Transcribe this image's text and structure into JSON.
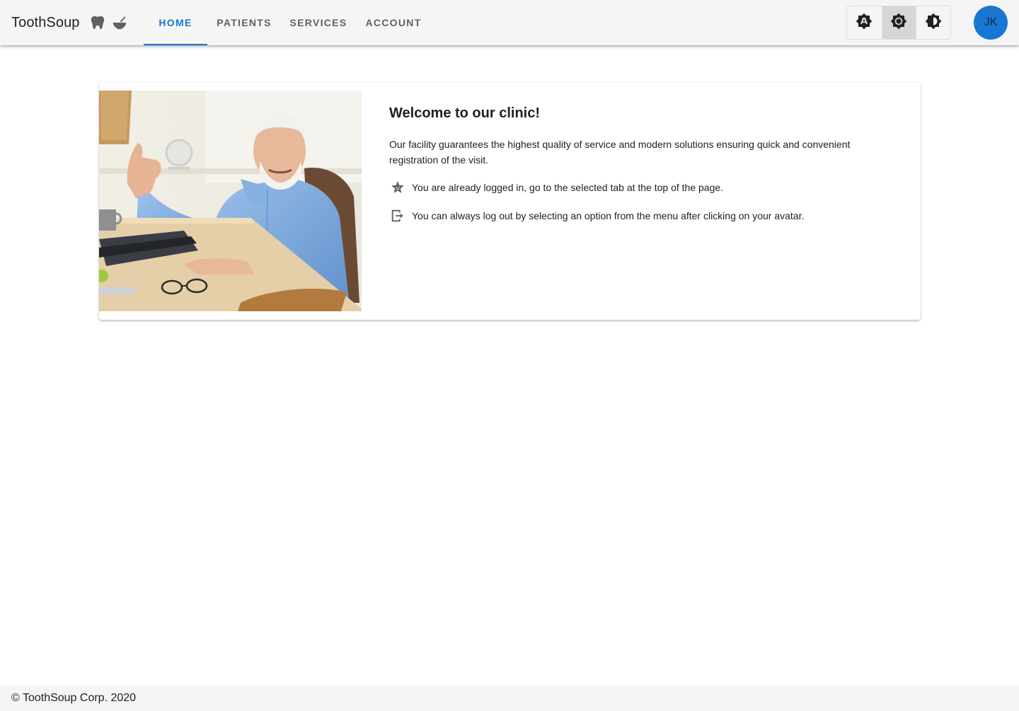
{
  "app": {
    "title": "ToothSoup",
    "brand_icons": [
      "tooth-icon",
      "mortar-pestle-icon"
    ]
  },
  "nav": {
    "tabs": [
      {
        "label": "HOME",
        "active": true
      },
      {
        "label": "PATIENTS",
        "active": false
      },
      {
        "label": "SERVICES",
        "active": false
      },
      {
        "label": "ACCOUNT",
        "active": false
      }
    ]
  },
  "theme_toggle": {
    "options": [
      "brightness-auto-icon",
      "light-mode-icon",
      "dark-mode-icon"
    ],
    "selected": "light-mode-icon"
  },
  "user": {
    "initials": "JK"
  },
  "welcome": {
    "title": "Welcome to our clinic!",
    "description": "Our facility guarantees the highest quality of service and modern solutions ensuring quick and convenient registration of the visit.",
    "items": [
      {
        "icon": "star-face-icon",
        "text": "You are already logged in, go to the selected tab at the top of the page."
      },
      {
        "icon": "logout-icon",
        "text": "You can always log out by selecting an option from the menu after clicking on your avatar."
      }
    ]
  },
  "footer": {
    "text": "© ToothSoup Corp. 2020"
  },
  "colors": {
    "primary": "#1976d2",
    "appbar": "#f5f5f5",
    "text": "#212121",
    "muted": "#616161"
  }
}
